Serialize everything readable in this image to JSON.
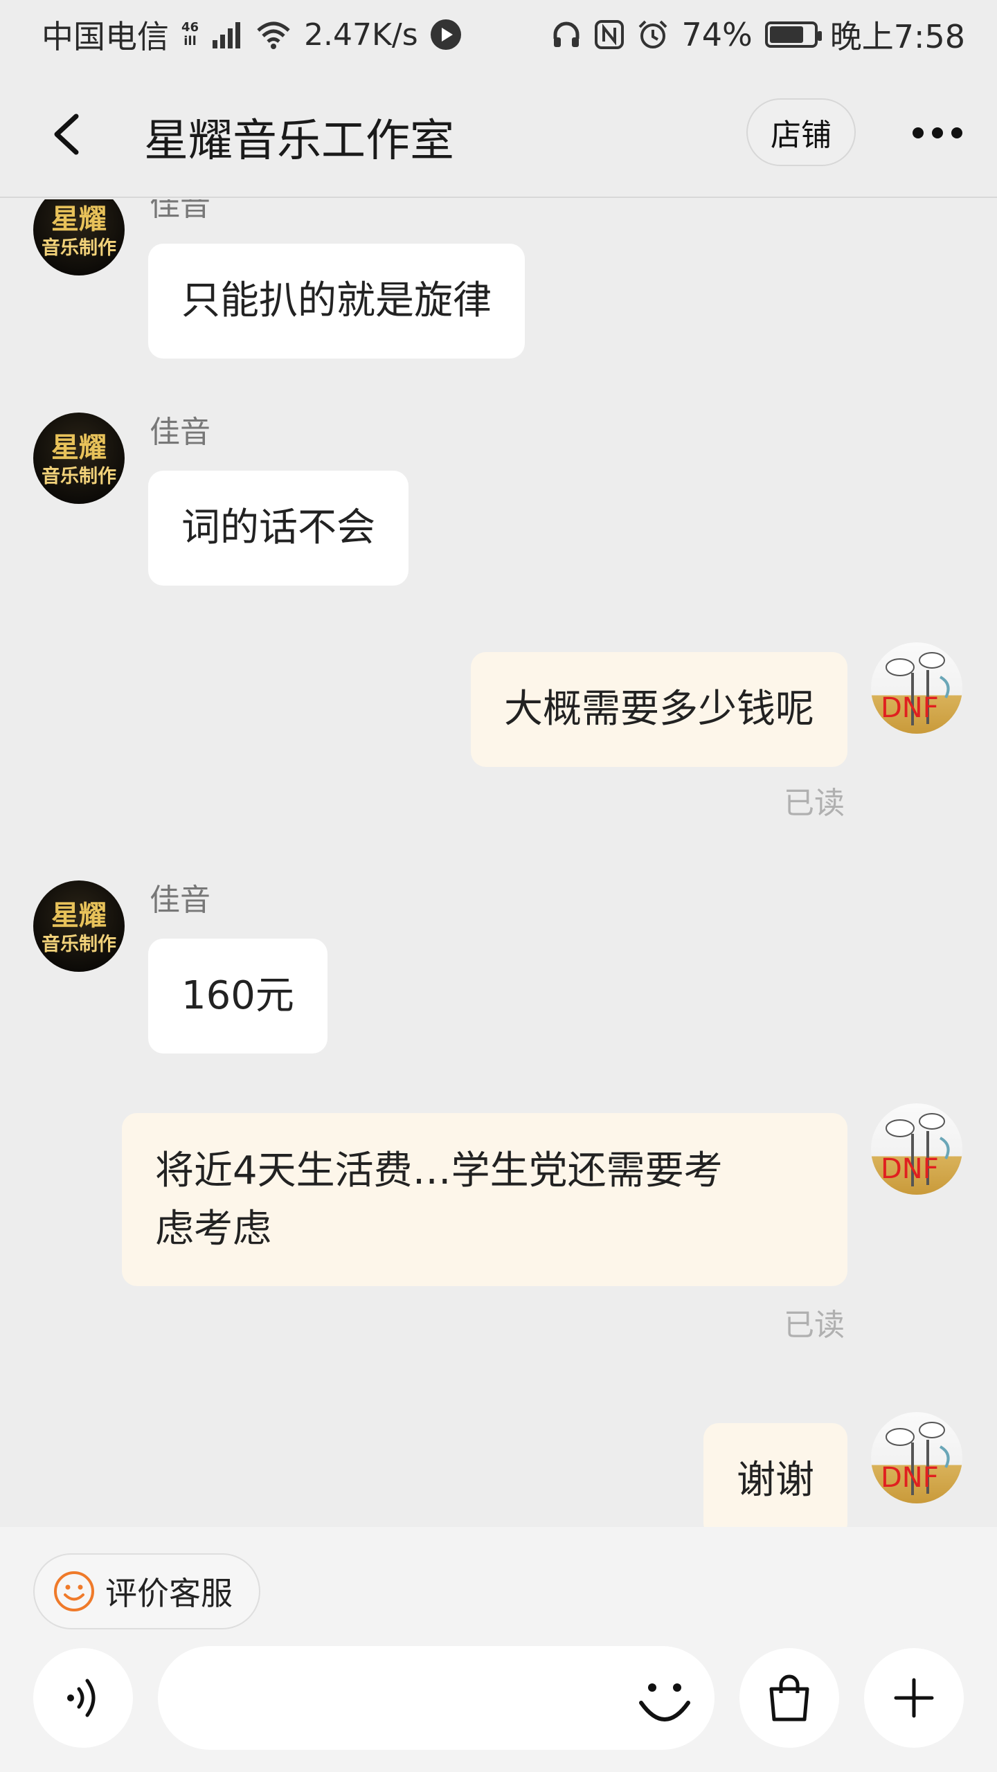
{
  "status_bar": {
    "carrier": "中国电信",
    "network_top": "46",
    "network_bottom": "ill",
    "speed": "2.47K/s",
    "battery": "74%",
    "time": "晚上7:58"
  },
  "header": {
    "title": "星耀音乐工作室",
    "shop_button": "店铺"
  },
  "shop_avatar": {
    "line1": "星耀",
    "line2": "音乐制作"
  },
  "user_avatar": {
    "text": "DNF"
  },
  "messages": [
    {
      "direction": "incoming",
      "sender": "佳音",
      "text": "只能扒的就是旋律"
    },
    {
      "direction": "incoming",
      "sender": "佳音",
      "text": "词的话不会"
    },
    {
      "direction": "outgoing",
      "text": "大概需要多少钱呢",
      "status": "已读"
    },
    {
      "direction": "incoming",
      "sender": "佳音",
      "text": "160元"
    },
    {
      "direction": "outgoing",
      "line1": "将近4天生活费…学生党还需要考",
      "line2": "虑考虑",
      "status": "已读"
    },
    {
      "direction": "outgoing",
      "text": "谢谢"
    }
  ],
  "bottom_bar": {
    "rate_button": "评价客服",
    "input_value": ""
  },
  "colors": {
    "background": "#ededed",
    "incoming_bubble": "#ffffff",
    "outgoing_bubble": "#fdf6ea",
    "accent_orange": "#ef7a2a",
    "read_text": "#b0b0b0"
  },
  "icons": [
    "back-icon",
    "more-icon",
    "voice-icon",
    "emoji-icon",
    "shopping-bag-icon",
    "plus-icon",
    "smiley-icon"
  ]
}
